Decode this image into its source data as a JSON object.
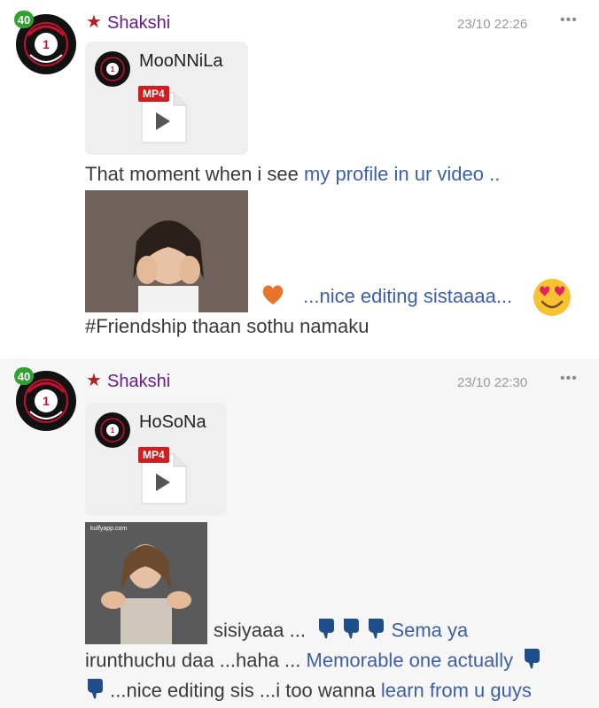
{
  "messages": [
    {
      "level": "40",
      "username": "Shakshi",
      "timestamp": "23/10 22:26",
      "more": "•••",
      "attachment": {
        "title": "MooNNiLa",
        "type": "MP4"
      },
      "line1": {
        "dark": "That moment when i see ",
        "blue": "my profile in ur video .."
      },
      "after_gif": "...nice editing sistaaaa...",
      "line_last": "#Friendship thaan sothu namaku"
    },
    {
      "level": "40",
      "username": "Shakshi",
      "timestamp": "23/10 22:30",
      "more": "•••",
      "attachment": {
        "title": "HoSoNa",
        "type": "MP4"
      },
      "gif_caption": "kulfyapp.com",
      "after_gif_dark": "sisiyaaa ...",
      "after_gif_blue": "Sema ya",
      "line2_dark": "irunthuchu daa ...haha ... ",
      "line2_blue": "Memorable one actually",
      "line3_dark": "...nice editing sis ...i too wanna ",
      "line3_blue": "learn from u guys"
    }
  ],
  "icons": {
    "star": "star-icon",
    "heart": "orange-heart-icon",
    "emoji": "smiling-face-with-heart-eyes-icon",
    "hands": "thumbs-down-blue-icon"
  },
  "colors": {
    "username": "#6a1b8f",
    "link_text": "#3d5fa8",
    "badge": "#2fa12f",
    "mp4": "#d01e1e"
  }
}
